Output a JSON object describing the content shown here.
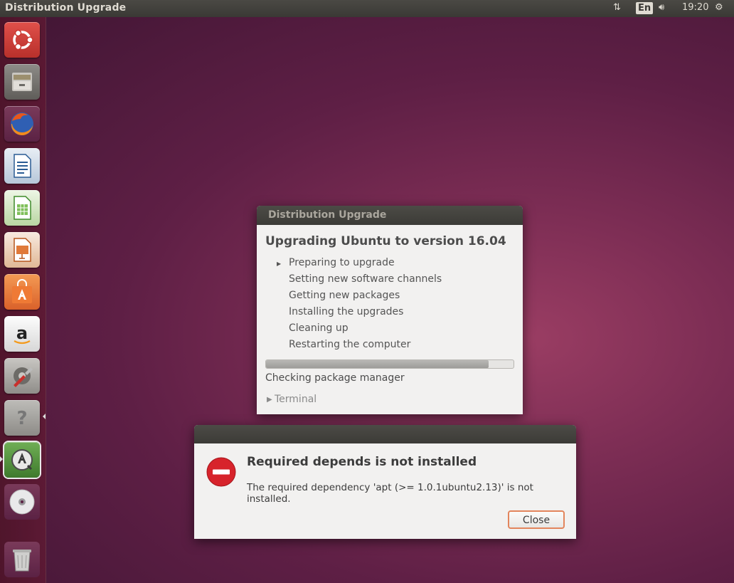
{
  "topbar": {
    "title": "Distribution Upgrade",
    "lang": "En",
    "clock": "19:20",
    "icons": [
      "network-updown-icon",
      "keyboard-language-icon",
      "volume-icon",
      "session-gear-icon"
    ]
  },
  "launcher": {
    "items": [
      "ubuntu-dash",
      "files",
      "firefox",
      "libreoffice-writer",
      "libreoffice-calc",
      "libreoffice-impress",
      "ubuntu-software-center",
      "amazon",
      "system-settings",
      "help",
      "software-updater",
      "dvd",
      "trash"
    ]
  },
  "upgrade_dialog": {
    "title": "Distribution Upgrade",
    "heading": "Upgrading Ubuntu to version 16.04",
    "steps": [
      "Preparing to upgrade",
      "Setting new software channels",
      "Getting new packages",
      "Installing the upgrades",
      "Cleaning up",
      "Restarting the computer"
    ],
    "current_step": 0,
    "progress": 0.9,
    "status": "Checking package manager",
    "terminal_label": "Terminal"
  },
  "error_dialog": {
    "title": "Required depends is not installed",
    "message": "The required dependency 'apt (>= 1.0.1ubuntu2.13)' is not installed.",
    "close_label": "Close"
  },
  "colors": {
    "accent": "#e3855c",
    "error_red": "#d7232b",
    "panel": "#3c3b37"
  }
}
